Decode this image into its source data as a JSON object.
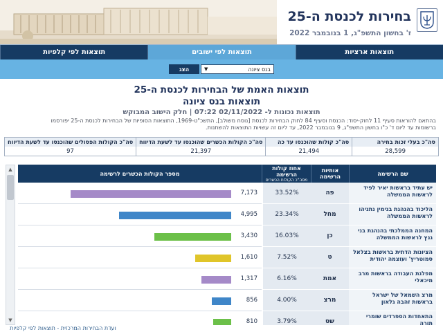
{
  "header": {
    "title": "בחירות לכנסת ה-25",
    "date": "ז' בחשון התשפ\"ג, 1 בנובמבר 2022"
  },
  "tabs": [
    {
      "label": "תוצאות ארציות",
      "active": false
    },
    {
      "label": "תוצאות לפי ישובים",
      "active": true
    },
    {
      "label": "תוצאות לפי קלפיות",
      "active": false
    }
  ],
  "search": {
    "selected_city": "בנס ציונה",
    "go_label": "הצג"
  },
  "page": {
    "title_main": "תוצאות האמת של הבחירות לכנסת ה-25",
    "title_city": "תוצאות בנס ציונה",
    "updated": "תוצאות נכונות ל- 02/11/2022 07:22 | חלק הישוב המבוקש",
    "notice_line1": "בהתאם להוראות סעיף 11 לחוק-יסוד: הכנסת וסעיף 84 לחוק הבחירות לכנסת [נוסח משולב], התשכ\"ט-1969, התוצאות הסופיות של הבחירות לכנסת ה-25 יפורסמו",
    "notice_line2": "ברשומות עד ליום ד' כ\"ו בחשון התשפ\"ג, 9 בנובמבר 2022, עד ליום זה עשויות התוצאות להשתנות."
  },
  "summary": [
    {
      "label": "סה\"כ בעלי זכות בחירה",
      "value": "28,599"
    },
    {
      "label": "סה\"כ קולות שהוכנסו עד כה",
      "value": "21,494"
    },
    {
      "label": "סה\"כ הקולות הכשרים שהוכנסו עד לשעת הדיווח",
      "value": "21,397"
    },
    {
      "label": "סה\"כ הקולות הפסולים שהוכנסו עד לשעת הדיווח",
      "value": "97"
    }
  ],
  "table_headers": {
    "name": "שם הרשימה",
    "letters_line1": "אותיות",
    "letters_line2": "הרשימה",
    "pct_line1": "אחוז קולות הרשימה",
    "pct_line2": "מסה\"כ הקולות הכשרים",
    "chart": "מספר הקולות הכשרים לרשימה"
  },
  "rows": [
    {
      "name": "יש עתיד בראשות יאיר לפיד לראשות הממשלה",
      "letters": "פה",
      "pct": "33.52%",
      "votes": "7,173",
      "votes_num": 7173,
      "color": "#a58ac8"
    },
    {
      "name": "הליכוד בהנהגת בנימין נתניהו לראשות הממשלה",
      "letters": "מחל",
      "pct": "23.34%",
      "votes": "4,995",
      "votes_num": 4995,
      "color": "#3f86c8"
    },
    {
      "name": "המחנה הממלכתי בהנהגת בני גנץ לראשות הממשלה",
      "letters": "כן",
      "pct": "16.03%",
      "votes": "3,430",
      "votes_num": 3430,
      "color": "#6cc049"
    },
    {
      "name": "הציונות הדתית בראשות בצלאל סמוטריץ' ועוצמה יהודית",
      "letters": "ט",
      "pct": "7.52%",
      "votes": "1,610",
      "votes_num": 1610,
      "color": "#e0c52a"
    },
    {
      "name": "מפלגת העבודה בראשות מרב מיכאלי",
      "letters": "אמת",
      "pct": "6.16%",
      "votes": "1,317",
      "votes_num": 1317,
      "color": "#a58ac8"
    },
    {
      "name": "מרצ השמאל של ישראל בראשות זהבה גלאון",
      "letters": "מרצ",
      "pct": "4.00%",
      "votes": "856",
      "votes_num": 856,
      "color": "#3f86c8"
    },
    {
      "name": "התאחדות הספרדים שומרי תורה",
      "letters": "שס",
      "pct": "3.79%",
      "votes": "810",
      "votes_num": 810,
      "color": "#6cc049"
    }
  ],
  "chart_data": {
    "type": "bar",
    "categories": [
      "פה",
      "מחל",
      "כן",
      "ט",
      "אמת",
      "מרצ",
      "שס"
    ],
    "values": [
      7173,
      4995,
      3430,
      1610,
      1317,
      856,
      810
    ],
    "title": "מספר הקולות הכשרים לרשימה",
    "xlabel": "",
    "ylabel": ""
  },
  "footer": {
    "text": "ועדת הבחירות המרכזית - תוצאות לפי קלפיות"
  }
}
